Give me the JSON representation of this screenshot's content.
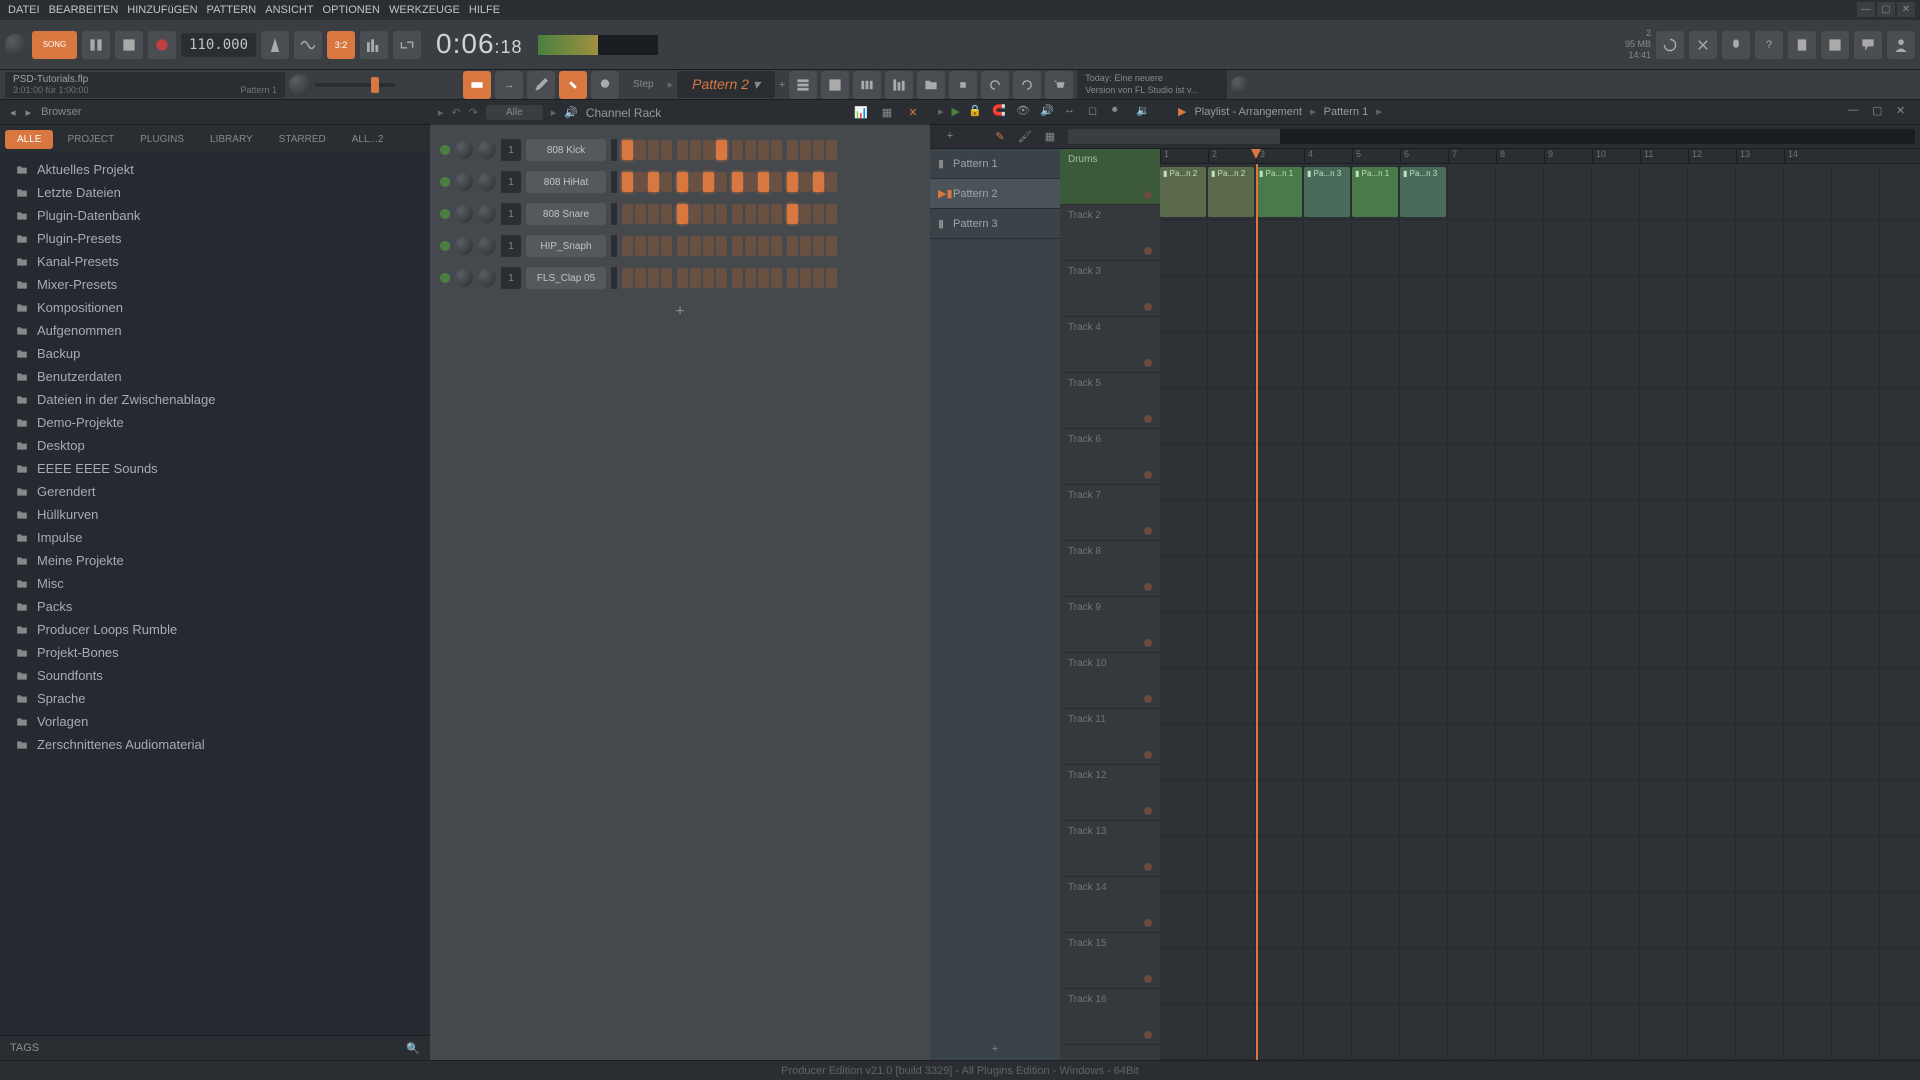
{
  "menu": {
    "items": [
      "DATEI",
      "BEARBEITEN",
      "HINZUFüGEN",
      "PATTERN",
      "ANSICHT",
      "OPTIONEN",
      "WERKZEUGE",
      "HILFE"
    ]
  },
  "toolbar": {
    "song_btn": "SONG",
    "tempo": "110.000",
    "time": "0:06",
    "time_frac": ":18",
    "beat_mode": "3:2",
    "step_label": "Step",
    "pattern_select": "Pattern 2",
    "cpu": "2",
    "mem": "95 MB",
    "clock": "14:41",
    "hint_title": "Today: Eine neuere",
    "hint_sub": "Version von FL Studio ist v..."
  },
  "info": {
    "filename": "PSD-Tutorials.flp",
    "status_left": "3:01:00 für 1:00:00",
    "status_right": "Pattern 1"
  },
  "browser": {
    "title": "Browser",
    "tabs": [
      "ALLE",
      "PROJECT",
      "PLUGINS",
      "LIBRARY",
      "STARRED",
      "ALL...2"
    ],
    "active_tab": 0,
    "items": [
      "Aktuelles Projekt",
      "Letzte Dateien",
      "Plugin-Datenbank",
      "Plugin-Presets",
      "Kanal-Presets",
      "Mixer-Presets",
      "Kompositionen",
      "Aufgenommen",
      "Backup",
      "Benutzerdaten",
      "Dateien in der Zwischenablage",
      "Demo-Projekte",
      "Desktop",
      "EEEE EEEE Sounds",
      "Gerendert",
      "Hüllkurven",
      "Impulse",
      "Meine Projekte",
      "Misc",
      "Packs",
      "Producer Loops Rumble",
      "Projekt-Bones",
      "Soundfonts",
      "Sprache",
      "Vorlagen",
      "Zerschnittenes Audiomaterial"
    ],
    "footer_tags": "TAGS"
  },
  "channel_rack": {
    "title": "Channel Rack",
    "filter": "Alle",
    "add": "+",
    "channels": [
      {
        "name": "808 Kick",
        "num": "1",
        "steps": [
          1,
          0,
          0,
          0,
          0,
          0,
          0,
          1,
          0,
          0,
          0,
          0,
          0,
          0,
          0,
          0
        ]
      },
      {
        "name": "808 HiHat",
        "num": "1",
        "steps": [
          1,
          0,
          1,
          0,
          1,
          0,
          1,
          0,
          1,
          0,
          1,
          0,
          1,
          0,
          1,
          0
        ]
      },
      {
        "name": "808 Snare",
        "num": "1",
        "steps": [
          0,
          0,
          0,
          0,
          1,
          0,
          0,
          0,
          0,
          0,
          0,
          0,
          1,
          0,
          0,
          0
        ]
      },
      {
        "name": "HIP_Snaph",
        "num": "1",
        "steps": [
          0,
          0,
          0,
          0,
          0,
          0,
          0,
          0,
          0,
          0,
          0,
          0,
          0,
          0,
          0,
          0
        ]
      },
      {
        "name": "FLS_Clap 05",
        "num": "1",
        "steps": [
          0,
          0,
          0,
          0,
          0,
          0,
          0,
          0,
          0,
          0,
          0,
          0,
          0,
          0,
          0,
          0
        ]
      }
    ]
  },
  "playlist": {
    "title_a": "Playlist - Arrangement",
    "title_b": "Pattern 1",
    "patterns": [
      "Pattern 1",
      "Pattern 2",
      "Pattern 3"
    ],
    "selected_pattern": 1,
    "bars": [
      "1",
      "2",
      "3",
      "4",
      "5",
      "6",
      "7",
      "8",
      "9",
      "10",
      "11",
      "12",
      "13",
      "14"
    ],
    "tracks": [
      "Drums",
      "Track 2",
      "Track 3",
      "Track 4",
      "Track 5",
      "Track 6",
      "Track 7",
      "Track 8",
      "Track 9",
      "Track 10",
      "Track 11",
      "Track 12",
      "Track 13",
      "Track 14",
      "Track 15",
      "Track 16"
    ],
    "clips": [
      {
        "track": 0,
        "bar": 1,
        "len": 1,
        "label": "Pa...n 2",
        "cls": "p2"
      },
      {
        "track": 0,
        "bar": 2,
        "len": 1,
        "label": "Pa...n 2",
        "cls": "p2"
      },
      {
        "track": 0,
        "bar": 3,
        "len": 1,
        "label": "Pa...n 1",
        "cls": ""
      },
      {
        "track": 0,
        "bar": 4,
        "len": 1,
        "label": "Pa...n 3",
        "cls": "p3"
      },
      {
        "track": 0,
        "bar": 5,
        "len": 1,
        "label": "Pa...n 1",
        "cls": ""
      },
      {
        "track": 0,
        "bar": 6,
        "len": 1,
        "label": "Pa...n 3",
        "cls": "p3"
      }
    ],
    "playhead_bar": 3.0
  },
  "footer": {
    "text": "Producer Edition v21.0 [build 3329] - All Plugins Edition - Windows - 64Bit"
  }
}
